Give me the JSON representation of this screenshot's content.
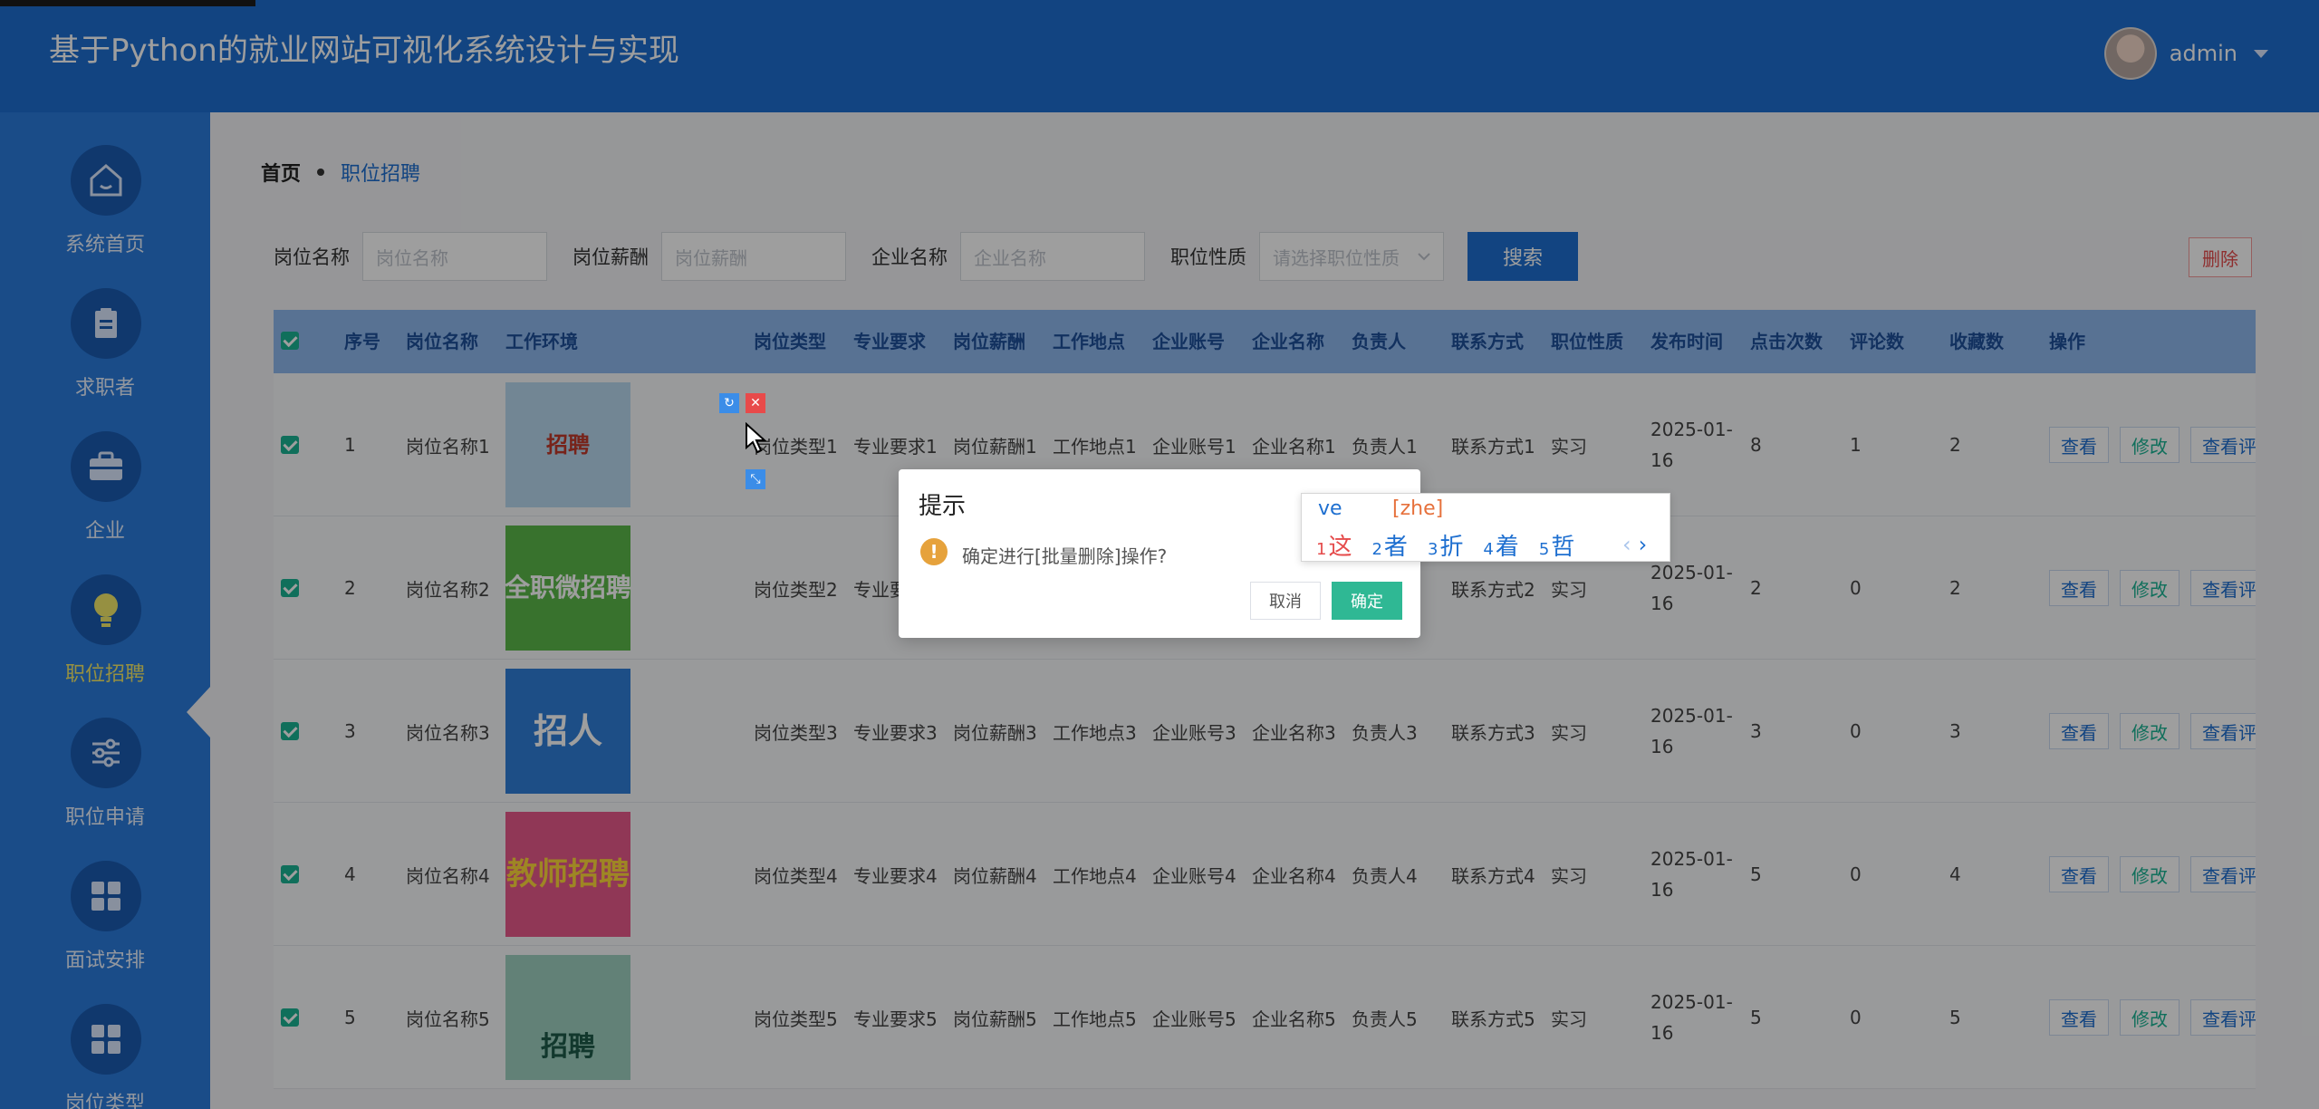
{
  "app": {
    "title": "基于Python的就业网站可视化系统设计与实现",
    "user": "admin"
  },
  "sidebar": {
    "items": [
      {
        "label": "系统首页",
        "icon": "home-icon"
      },
      {
        "label": "求职者",
        "icon": "clipboard-icon"
      },
      {
        "label": "企业",
        "icon": "briefcase-icon"
      },
      {
        "label": "职位招聘",
        "icon": "lightbulb-icon",
        "active": true
      },
      {
        "label": "职位申请",
        "icon": "sliders-icon"
      },
      {
        "label": "面试安排",
        "icon": "grid-icon"
      },
      {
        "label": "岗位类型",
        "icon": "grid-icon"
      }
    ]
  },
  "breadcrumb": {
    "home": "首页",
    "current": "职位招聘"
  },
  "filters": {
    "job_name_label": "岗位名称",
    "job_name_placeholder": "岗位名称",
    "salary_label": "岗位薪酬",
    "salary_placeholder": "岗位薪酬",
    "company_label": "企业名称",
    "company_placeholder": "企业名称",
    "nature_label": "职位性质",
    "nature_placeholder": "请选择职位性质",
    "search_label": "搜索",
    "delete_label": "删除"
  },
  "table": {
    "headers": [
      "序号",
      "岗位名称",
      "工作环境",
      "岗位类型",
      "专业要求",
      "岗位薪酬",
      "工作地点",
      "企业账号",
      "企业名称",
      "负责人",
      "联系方式",
      "职位性质",
      "发布时间",
      "点击次数",
      "评论数",
      "收藏数",
      "操作"
    ],
    "rows": [
      {
        "no": "1",
        "name": "岗位名称1",
        "type": "岗位类型1",
        "major": "专业要求1",
        "salary": "岗位薪酬1",
        "place": "工作地点1",
        "account": "企业账号1",
        "company": "企业名称1",
        "owner": "负责人1",
        "contact": "联系方式1",
        "nature": "实习",
        "time": "2025-01-16",
        "clicks": "8",
        "comments": "1",
        "favs": "2",
        "img": "招聘"
      },
      {
        "no": "2",
        "name": "岗位名称2",
        "type": "岗位类型2",
        "major": "专业要",
        "salary": "",
        "place": "",
        "account": "",
        "company": "",
        "owner": "",
        "contact": "联系方式2",
        "nature": "实习",
        "time": "2025-01-16",
        "clicks": "2",
        "comments": "0",
        "favs": "2",
        "img": "全职微招聘"
      },
      {
        "no": "3",
        "name": "岗位名称3",
        "type": "岗位类型3",
        "major": "专业要求3",
        "salary": "岗位薪酬3",
        "place": "工作地点3",
        "account": "企业账号3",
        "company": "企业名称3",
        "owner": "负责人3",
        "contact": "联系方式3",
        "nature": "实习",
        "time": "2025-01-16",
        "clicks": "3",
        "comments": "0",
        "favs": "3",
        "img": "招人"
      },
      {
        "no": "4",
        "name": "岗位名称4",
        "type": "岗位类型4",
        "major": "专业要求4",
        "salary": "岗位薪酬4",
        "place": "工作地点4",
        "account": "企业账号4",
        "company": "企业名称4",
        "owner": "负责人4",
        "contact": "联系方式4",
        "nature": "实习",
        "time": "2025-01-16",
        "clicks": "5",
        "comments": "0",
        "favs": "4",
        "img": "教师招聘"
      },
      {
        "no": "5",
        "name": "岗位名称5",
        "type": "岗位类型5",
        "major": "专业要求5",
        "salary": "岗位薪酬5",
        "place": "工作地点5",
        "account": "企业账号5",
        "company": "企业名称5",
        "owner": "负责人5",
        "contact": "联系方式5",
        "nature": "实习",
        "time": "2025-01-16",
        "clicks": "5",
        "comments": "0",
        "favs": "5",
        "img": "招聘"
      }
    ],
    "ops": {
      "view": "查看",
      "edit": "修改",
      "comments": "查看评论"
    }
  },
  "dialog": {
    "title": "提示",
    "message": "确定进行[批量删除]操作?",
    "cancel": "取消",
    "ok": "确定"
  },
  "ime": {
    "composition": "ve",
    "pinyin": "[zhe]",
    "candidates": [
      {
        "n": "1",
        "c": "这"
      },
      {
        "n": "2",
        "c": "者"
      },
      {
        "n": "3",
        "c": "折"
      },
      {
        "n": "4",
        "c": "着"
      },
      {
        "n": "5",
        "c": "哲"
      }
    ],
    "prev": "‹",
    "next": "›"
  },
  "colors": {
    "primary": "#1e6fd0",
    "success": "#1ab394",
    "danger": "#e54b4b",
    "warning": "#e6a23c"
  }
}
